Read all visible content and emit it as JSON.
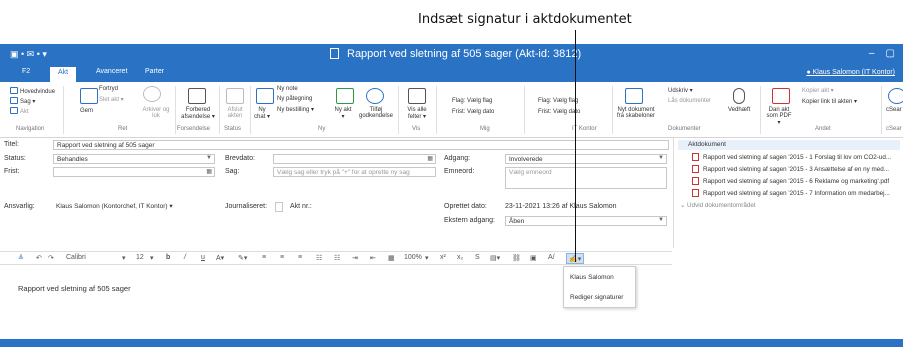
{
  "annotation": {
    "text": "Indsæt signatur i aktdokumentet"
  },
  "window": {
    "qat": "▣ • ✉ • ▾",
    "title": "Rapport ved sletning af 505 sager (Akt-id: 3812)",
    "minimize": "–",
    "maximize": "▢"
  },
  "tabs": [
    {
      "label": "F2"
    },
    {
      "label": "Akt"
    },
    {
      "label": "Avanceret"
    },
    {
      "label": "Parter"
    }
  ],
  "user": "Klaus Salomon (IT Kontor)",
  "ribbon": {
    "nav": {
      "items": [
        "Hovedvindue",
        "Sag ▾",
        "Akt"
      ],
      "label": "Navigation"
    },
    "ret": {
      "gem": "Gem",
      "fortryd": "Fortryd",
      "slet": "Slet akt ▾",
      "arkiver": "Arkiver og luk",
      "label": "Ret"
    },
    "forsendelse": {
      "forbered": "Forbered afsendelse ▾",
      "label": "Forsendelse"
    },
    "status": {
      "afslut": "Afslut akten",
      "label": "Status"
    },
    "ny": {
      "chat": "Ny chat ▾",
      "note": "Ny note",
      "paategning": "Ny påtegning",
      "bestilling": "Ny bestilling ▾",
      "akt": "Ny akt ▾",
      "tilfoej": "Tilføj godkendelse",
      "label": "Ny"
    },
    "vis": {
      "felter": "Vis alle felter ▾",
      "label": "Vis"
    },
    "mig": {
      "flag": "Flag: Vælg flag",
      "frist": "Frist: Vælg dato",
      "label": "Mig"
    },
    "itkontor": {
      "flag": "Flag: Vælg flag",
      "frist": "Frist: Vælg dato",
      "label": "IT Kontor"
    },
    "dok": {
      "nyt": "Nyt dokument fra skabeloner",
      "udskriv": "Udskriv ▾",
      "laas": "Lås dokumenter",
      "vedhaeft": "Vedhæft",
      "label": "Dokumenter"
    },
    "andet": {
      "danakt": "Dan akt som PDF ▾",
      "kopier": "Kopier akt ▾",
      "kopierlink": "Kopier link til akten ▾",
      "label": "Andet"
    },
    "search": {
      "text": "cSear",
      "label": "cSear"
    }
  },
  "form": {
    "titel_label": "Titel:",
    "titel": "Rapport ved sletning af 505 sager",
    "status_label": "Status:",
    "status": "Behandles",
    "frist_label": "Frist:",
    "frist": "",
    "brevdato_label": "Brevdato:",
    "brevdato": "",
    "sag_label": "Sag:",
    "sag_ph": "Vælg sag eller tryk på \"+\" for at oprette ny sag",
    "adgang_label": "Adgang:",
    "adgang": "Involverede",
    "emneord_label": "Emneord:",
    "emneord_ph": "Vælg emneord",
    "ansvarlig_label": "Ansvarlig:",
    "ansvarlig": "Klaus Salomon (Kontorchef, IT Kontor) ▾",
    "journal_label": "Journaliseret:",
    "aktnr_label": "Akt nr.:",
    "oprettet_label": "Oprettet dato:",
    "oprettet": "23-11-2021 13:26   af   Klaus Salomon",
    "ekstern_label": "Ekstern adgang:",
    "ekstern": "Åben"
  },
  "docs": {
    "header": "Aktdokument",
    "items": [
      "Rapport ved sletning af sagen '2015 - 1 Forslag til lov om CO2-ud...",
      "Rapport ved sletning af sagen '2015 - 3 Ansættelse af en ny med...",
      "Rapport ved sletning af sagen '2015 - 6 Reklame og marketing'.pdf",
      "Rapport ved sletning af sagen '2015 - 7 Information om medarbej..."
    ],
    "expand": "Udvid dokumentområdet"
  },
  "editor": {
    "font": "Calibri",
    "size": "12",
    "zoom": "100%",
    "bold": "b",
    "italic": "/",
    "underline": "u"
  },
  "sigmenu": {
    "items": [
      "Klaus Salomon",
      "Rediger signaturer"
    ]
  },
  "body": {
    "text": "Rapport ved sletning af 505 sager"
  },
  "colors": {
    "accent": "#2a72c4"
  }
}
